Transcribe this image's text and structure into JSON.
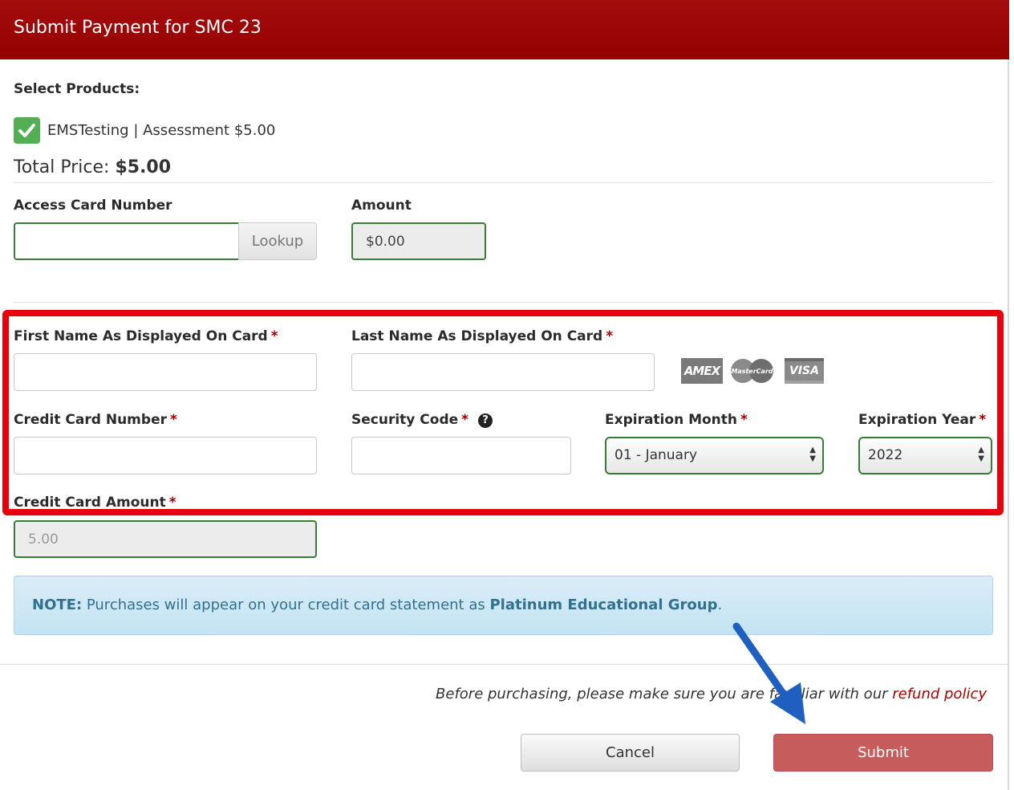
{
  "header": {
    "title": "Submit Payment for SMC 23"
  },
  "products": {
    "label": "Select Products:",
    "items": [
      {
        "name": "EMSTesting | Assessment $5.00",
        "checked": true
      }
    ],
    "total_label": "Total Price:",
    "total_value": "$5.00"
  },
  "access_card": {
    "label": "Access Card Number",
    "value": "",
    "lookup_label": "Lookup"
  },
  "amount": {
    "label": "Amount",
    "value": "$0.00"
  },
  "card_form": {
    "first_name": {
      "label": "First Name As Displayed On Card",
      "required": "*",
      "value": ""
    },
    "last_name": {
      "label": "Last Name As Displayed On Card",
      "required": "*",
      "value": ""
    },
    "card_logos": [
      "AMEX",
      "MasterCard",
      "VISA"
    ],
    "card_number": {
      "label": "Credit Card Number",
      "required": "*",
      "value": ""
    },
    "security_code": {
      "label": "Security Code",
      "required": "*",
      "help_icon": "question-circle-icon",
      "value": ""
    },
    "exp_month": {
      "label": "Expiration Month",
      "required": "*",
      "value": "01 - January"
    },
    "exp_year": {
      "label": "Expiration Year",
      "required": "*",
      "value": "2022"
    },
    "cc_amount": {
      "label": "Credit Card Amount",
      "required": "*",
      "value": "5.00"
    }
  },
  "note": {
    "prefix": "NOTE:",
    "text": " Purchases will appear on your credit card statement as ",
    "company": "Platinum Educational Group",
    "suffix": "."
  },
  "footer": {
    "policy_text": "Before purchasing, please make sure you are familiar with our ",
    "policy_link": "refund policy",
    "cancel_label": "Cancel",
    "submit_label": "Submit"
  },
  "colors": {
    "header": "#9b0000",
    "accent_green": "#3b7a3b",
    "highlight": "#e8000a",
    "arrow": "#1e5fc0"
  }
}
